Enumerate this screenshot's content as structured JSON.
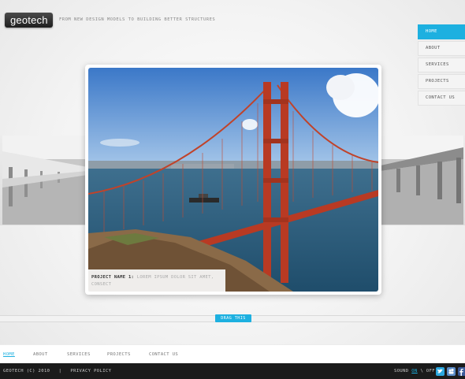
{
  "header": {
    "logo": "geotech",
    "tagline": "FROM NEW DESIGN MODELS TO BUILDING BETTER STRUCTURES"
  },
  "nav": {
    "items": [
      {
        "label": "HOME",
        "active": true
      },
      {
        "label": "ABOUT"
      },
      {
        "label": "SERVICES"
      },
      {
        "label": "PROJECTS"
      },
      {
        "label": "CONTACT US"
      }
    ]
  },
  "slider": {
    "caption_title": "PROJECT NAME 1:",
    "caption_text": "LOREM IPSUM DOLOR SIT AMET, CONSECT",
    "drag_label": "DRAG THIS"
  },
  "bottom_nav": {
    "items": [
      {
        "label": "HOME",
        "active": true
      },
      {
        "label": "ABOUT"
      },
      {
        "label": "SERVICES"
      },
      {
        "label": "PROJECTS"
      },
      {
        "label": "CONTACT US"
      }
    ]
  },
  "footer": {
    "copyright": "GEOTECH (C) 2010",
    "separator": "|",
    "privacy": "PRIVACY POLICY",
    "sound_label": "SOUND",
    "sound_on": "ON",
    "sound_sep": "\\",
    "sound_off": "OFF",
    "social_icons": [
      "twitter-icon",
      "myspace-icon",
      "facebook-icon"
    ]
  },
  "colors": {
    "accent": "#1db0e0",
    "footer_bg": "#1b1b1b"
  }
}
